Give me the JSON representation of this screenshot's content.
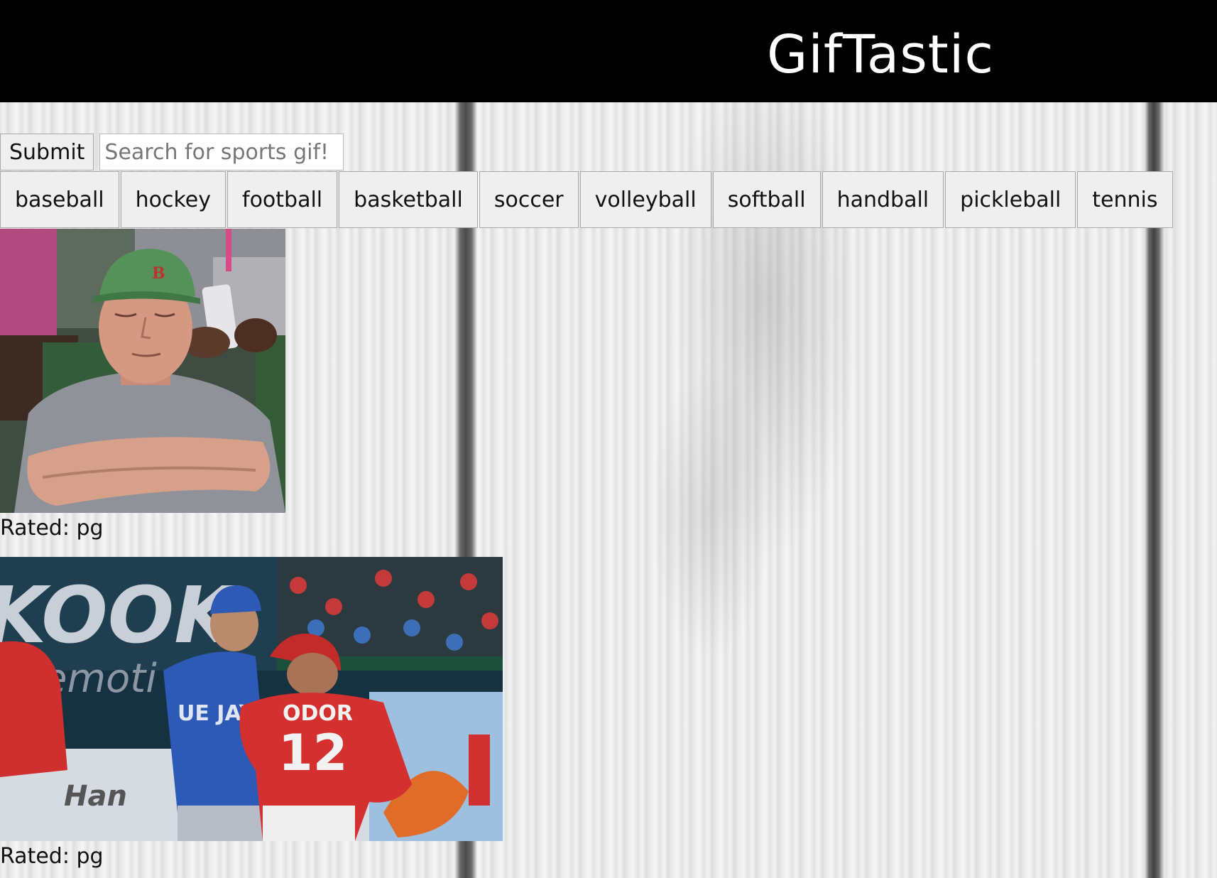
{
  "header": {
    "title": "GifTastic"
  },
  "search": {
    "submit_label": "Submit",
    "placeholder": "Search for sports gif!"
  },
  "sports": [
    "baseball",
    "hockey",
    "football",
    "basketball",
    "soccer",
    "volleyball",
    "softball",
    "handball",
    "pickleball",
    "tennis"
  ],
  "gifs": [
    {
      "rating": "Rated: pg"
    },
    {
      "rating": "Rated: pg"
    }
  ]
}
